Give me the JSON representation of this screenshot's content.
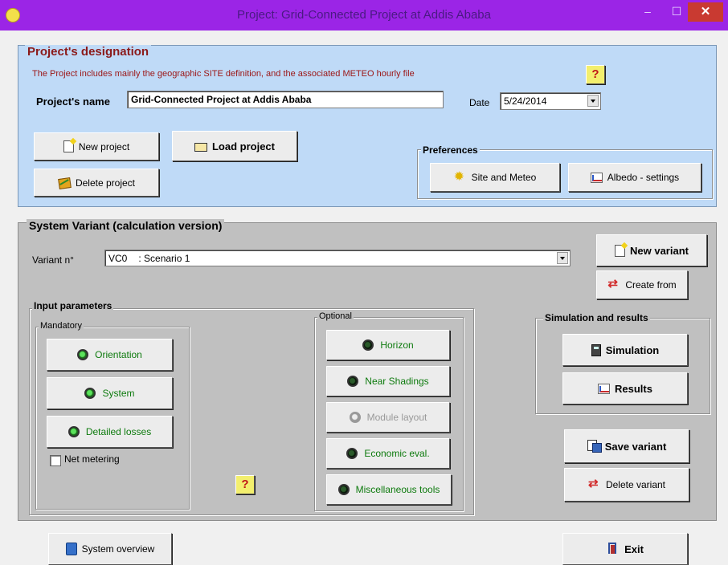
{
  "window": {
    "title": "Project:  Grid-Connected Project at Addis Ababa",
    "minimize_label": "–",
    "maximize_label": "☐",
    "close_label": "✕"
  },
  "project": {
    "group_label": "Project's designation",
    "description": "The Project includes mainly the geographic SITE definition, and the associated  METEO  hourly file",
    "help_label": "?",
    "name_label": "Project's name",
    "name_value": "Grid-Connected Project at Addis Ababa",
    "date_label": "Date",
    "date_value": "5/24/2014",
    "new_project": "New project",
    "load_project": "Load project",
    "delete_project": "Delete project",
    "preferences_label": "Preferences",
    "site_meteo": "Site and Meteo",
    "albedo_settings": "Albedo - settings"
  },
  "variant": {
    "group_label": "System Variant (calculation version)",
    "variant_label": "Variant n°",
    "variant_code": "VC0",
    "variant_name": ": Scenario 1",
    "new_variant": "New variant",
    "create_from": "Create from",
    "input_params_label": "Input parameters",
    "mandatory_label": "Mandatory",
    "orientation": "Orientation",
    "system": "System",
    "detailed_losses": "Detailed losses",
    "net_metering": "Net metering",
    "optional_label": "Optional",
    "horizon": "Horizon",
    "near_shadings": "Near Shadings",
    "module_layout": "Module layout",
    "economic_eval": "Economic eval.",
    "misc_tools": "Miscellaneous tools",
    "help_label": "?",
    "sim_results_label": "Simulation and results",
    "simulation": "Simulation",
    "results": "Results",
    "save_variant": "Save variant",
    "delete_variant": "Delete variant"
  },
  "footer": {
    "system_overview": "System overview",
    "exit": "Exit"
  },
  "colors": {
    "titlebar": "#9b25e6",
    "project_panel": "#bfdaf7",
    "variant_panel": "#c0c0c0",
    "accent_green": "#0d7a0d",
    "heading_red": "#8b1a1a"
  }
}
